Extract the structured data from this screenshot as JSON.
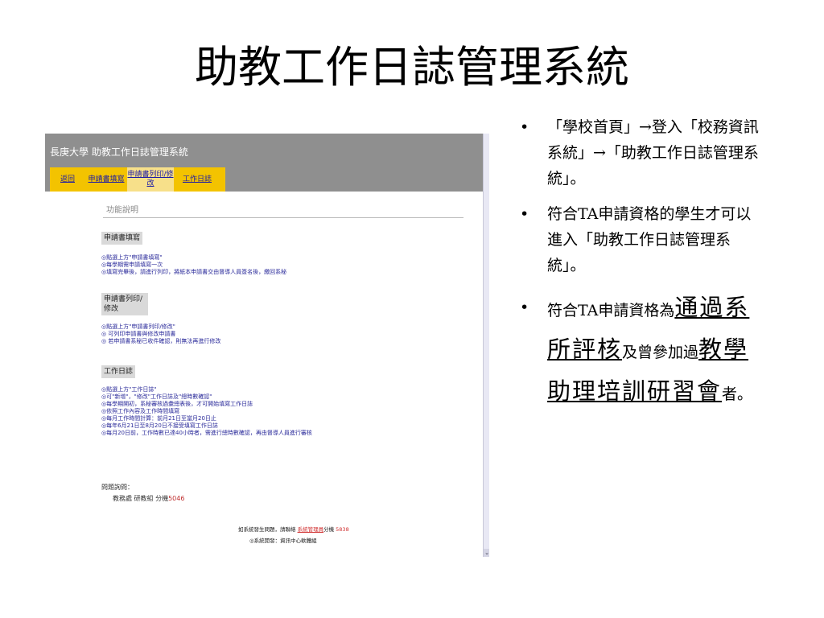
{
  "slide": {
    "title": "助教工作日誌管理系統"
  },
  "screenshot": {
    "site_title": "長庚大學  助教工作日誌管理系統",
    "nav": [
      "返回",
      "申請書填寫",
      "申請書列印/修改",
      "工作日誌"
    ],
    "func_title": "功能說明",
    "sections": [
      {
        "heading": "申請書填寫",
        "lines": [
          "◎點選上方\"申請書填寫\"",
          "◎每學期需申請填寫一次",
          "◎填寫完畢後，請進行列印，將紙本申請書交由督導人員簽名後，繳回系秘"
        ]
      },
      {
        "heading": "申請書列印/修改",
        "lines": [
          "◎點選上方\"申請書列印/修改\"",
          "◎ 可列印申請書與修改申請書",
          "◎ 若申請書系秘已收件確認，則無法再進行修改"
        ]
      },
      {
        "heading": "工作日誌",
        "lines": [
          "◎點選上方\"工作日誌\"",
          "◎可\"新增\"，\"修改\"工作日誌及\"總時數確認\"",
          "◎每學期開初，系秘審核過彙總表後，才可開始填寫工作日誌",
          "◎依照工作內容及工作時間填寫",
          "◎每月工作時間計算：前月21日至當月20日止",
          "◎每年6月21日至8月20日不接受填寫工作日誌",
          "◎每月20日前，工作時數已達40小時者，需進行總時數確認，再由督導人員進行審核"
        ]
      }
    ],
    "contact_label": "問題詢問：",
    "contact_office": "教務處  研教組 分機",
    "contact_ext": "5046",
    "footer_prefix": "如系統發生問題，請聯絡",
    "footer_link": "系統管理員",
    "footer_ext_label": "分機",
    "footer_ext": "5838",
    "footer_dev": "◎系統開發：資訊中心軟體組"
  },
  "bullets": {
    "b1": "「學校首頁」→登入「校務資訊系統」→「助教工作日誌管理系統」。",
    "b2": "符合TA申請資格的學生才可以進入「助教工作日誌管理系統」。",
    "b3_a": "符合TA申請資格為",
    "b3_b": "通過系所評核",
    "b3_c": "及曾參加過",
    "b3_d": "教學助理培訓研習會",
    "b3_e": "者。"
  },
  "colors": {
    "header_gray": "#8f8f8f",
    "nav_yellow": "#f3c300",
    "link_blue": "#1a1aa6"
  }
}
